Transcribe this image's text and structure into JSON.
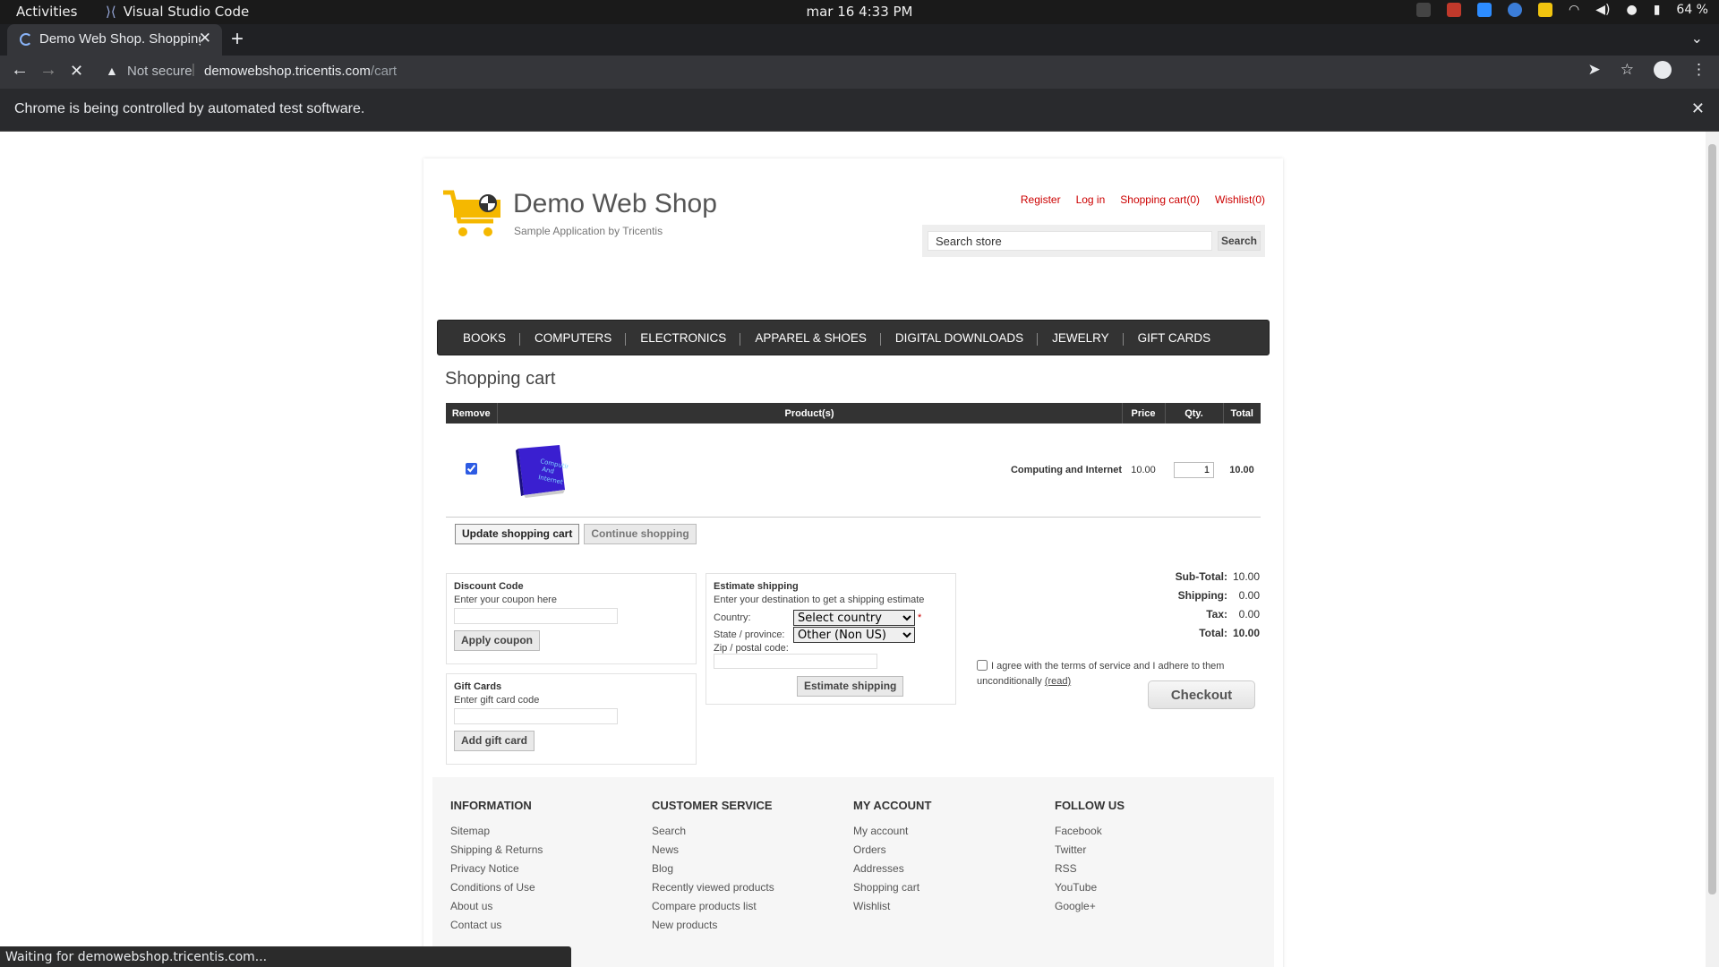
{
  "os": {
    "activities": "Activities",
    "app_name": "Visual Studio Code",
    "clock": "mar 16  4:33 PM",
    "battery": "64 %"
  },
  "browser": {
    "tab_title": "Demo Web Shop. Shopping Cart",
    "not_secure": "Not secure",
    "url_host": "demowebshop.tricentis.com",
    "url_path": "/cart",
    "infobar_message": "Chrome is being controlled by automated test software.",
    "status_text": "Waiting for demowebshop.tricentis.com..."
  },
  "header": {
    "site_title": "Demo Web Shop",
    "site_subtitle": "Sample Application by Tricentis",
    "links": {
      "register": "Register",
      "login": "Log in",
      "cart": "Shopping cart(0)",
      "wishlist": "Wishlist(0)"
    },
    "search_value": "Search store",
    "search_button": "Search"
  },
  "menu": [
    "BOOKS",
    "COMPUTERS",
    "ELECTRONICS",
    "APPAREL & SHOES",
    "DIGITAL DOWNLOADS",
    "JEWELRY",
    "GIFT CARDS"
  ],
  "cart": {
    "title": "Shopping cart",
    "columns": {
      "remove": "Remove",
      "product": "Product(s)",
      "price": "Price",
      "qty": "Qty.",
      "total": "Total"
    },
    "item": {
      "name": "Computing and Internet",
      "price": "10.00",
      "qty": "1",
      "total": "10.00",
      "remove_checked": true
    },
    "update_button": "Update shopping cart",
    "continue_button": "Continue shopping"
  },
  "discount": {
    "title": "Discount Code",
    "hint": "Enter your coupon here",
    "button": "Apply coupon"
  },
  "giftcards": {
    "title": "Gift Cards",
    "hint": "Enter gift card code",
    "button": "Add gift card"
  },
  "shipping": {
    "title": "Estimate shipping",
    "hint": "Enter your destination to get a shipping estimate",
    "country_label": "Country:",
    "country_value": "Select country",
    "state_label": "State / province:",
    "state_value": "Other (Non US)",
    "zip_label": "Zip / postal code:",
    "button": "Estimate shipping"
  },
  "totals": {
    "subtotal_label": "Sub-Total:",
    "subtotal": "10.00",
    "shipping_label": "Shipping:",
    "shipping": "0.00",
    "tax_label": "Tax:",
    "tax": "0.00",
    "total_label": "Total:",
    "total": "10.00",
    "terms_text": "I agree with the terms of service and I adhere to them unconditionally",
    "terms_link": "(read)",
    "checkout": "Checkout"
  },
  "footer": {
    "information": {
      "title": "INFORMATION",
      "links": [
        "Sitemap",
        "Shipping & Returns",
        "Privacy Notice",
        "Conditions of Use",
        "About us",
        "Contact us"
      ]
    },
    "customer_service": {
      "title": "CUSTOMER SERVICE",
      "links": [
        "Search",
        "News",
        "Blog",
        "Recently viewed products",
        "Compare products list",
        "New products"
      ]
    },
    "my_account": {
      "title": "MY ACCOUNT",
      "links": [
        "My account",
        "Orders",
        "Addresses",
        "Shopping cart",
        "Wishlist"
      ]
    },
    "follow_us": {
      "title": "FOLLOW US",
      "links": [
        "Facebook",
        "Twitter",
        "RSS",
        "YouTube",
        "Google+"
      ]
    }
  },
  "colors": {
    "link_red": "#cc0000",
    "total_green": "#2a8a00",
    "menu_bg": "#333333"
  }
}
